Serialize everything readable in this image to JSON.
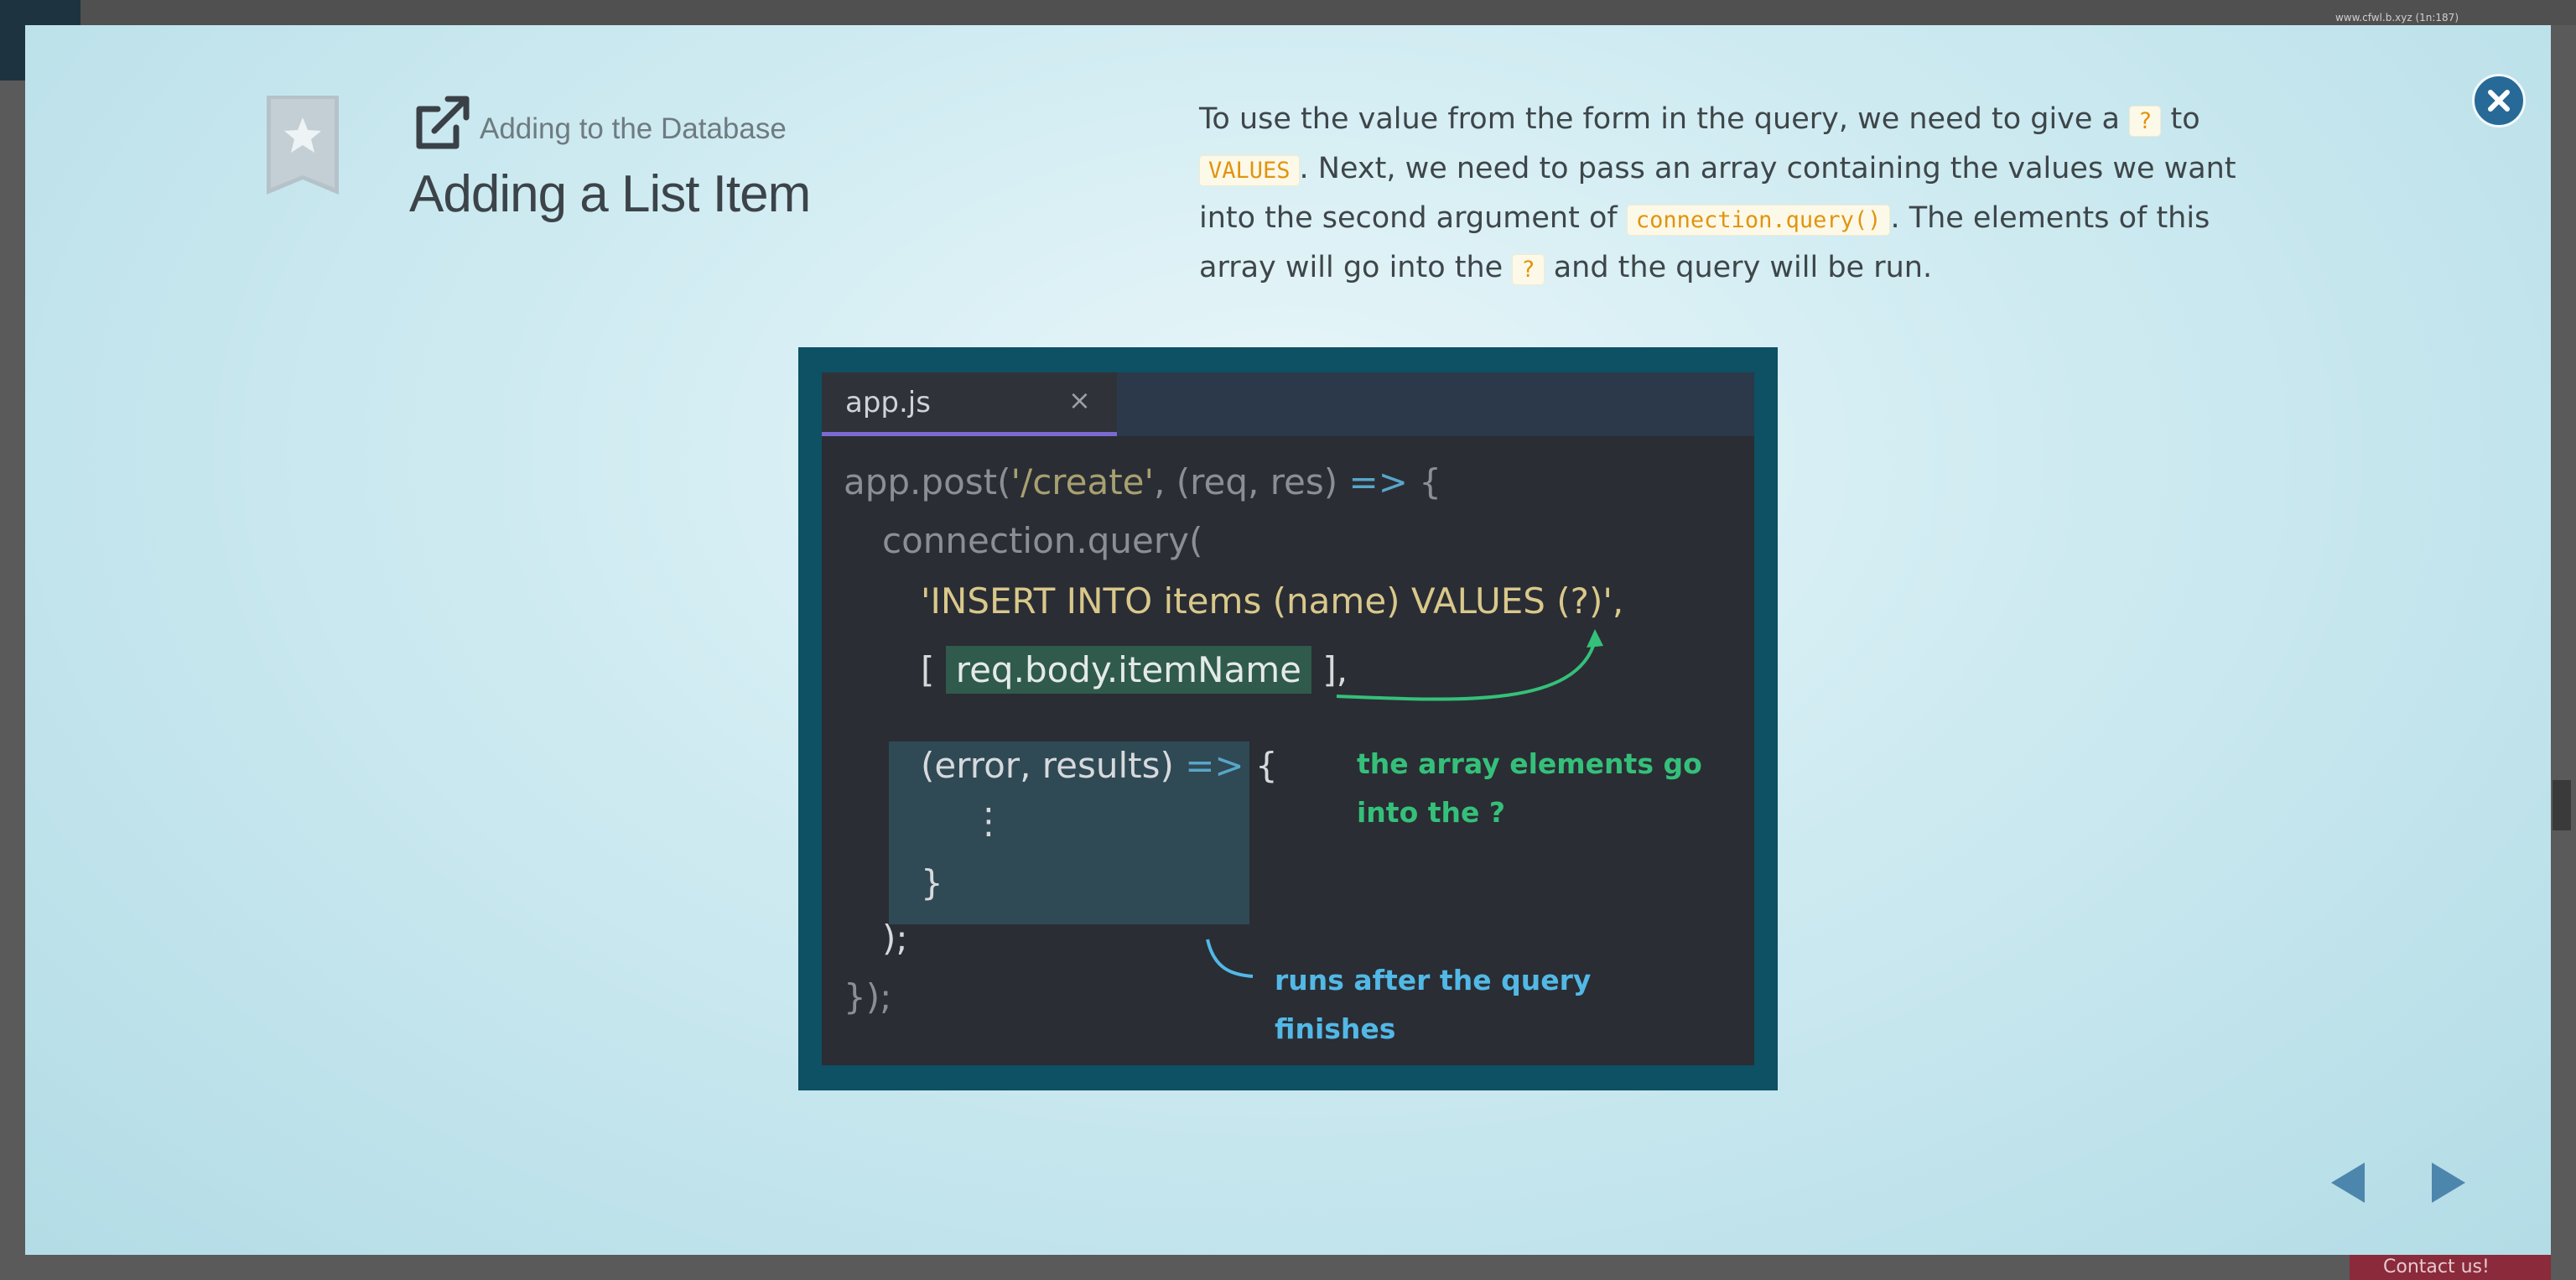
{
  "background": {
    "url_text": "www.cfwl.b.xyz (1n:187)",
    "contact_label": "Contact us!"
  },
  "header": {
    "subtitle": "Adding to the Database",
    "title": "Adding a List Item"
  },
  "description": {
    "line_parts": [
      "To use the value from the form in the query, we need to give a ",
      "?",
      " to ",
      "VALUES",
      ". Next, we need to pass an array containing the values we want into the second argument of ",
      "connection.query()",
      ". The elements of this array will go into the ",
      "?",
      " and the query will be run."
    ]
  },
  "code": {
    "tab_name": "app.js",
    "tab_close": "×",
    "lines": {
      "l1_a": "app.post(",
      "l1_b": "'/create'",
      "l1_c": ", (req, res) ",
      "l1_d": "=>",
      "l1_e": " {",
      "l2": "connection.query(",
      "l3": "'INSERT INTO items (name) VALUES (?)',",
      "l4_open": "[ ",
      "l4_hl": "req.body.itemName",
      "l4_close": " ],",
      "l5_a": "(error, results) ",
      "l5_b": "=>",
      "l5_c": " {",
      "l6": "⋮",
      "l7": "}",
      "l8": ");",
      "l9": "});"
    },
    "annotation_green": [
      "the array elements go",
      "into the ?"
    ],
    "annotation_blue": [
      "runs after the query",
      "finishes"
    ]
  },
  "colors": {
    "accent_blue": "#276a98",
    "code_bg": "#2a2d34",
    "frame": "#0e5064",
    "annotation_green": "#35c07a",
    "annotation_blue": "#52b8e6"
  }
}
